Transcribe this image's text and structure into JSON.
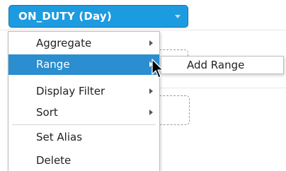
{
  "field_pill": {
    "label": "ON_DUTY (Day)",
    "color": "#1d9be0"
  },
  "context_menu": {
    "items": [
      {
        "label": "Aggregate",
        "has_submenu": true
      },
      {
        "label": "Range",
        "has_submenu": true,
        "highlighted": true
      },
      {
        "label": "Display Filter",
        "has_submenu": true
      },
      {
        "label": "Sort",
        "has_submenu": true
      },
      {
        "label": "Set Alias",
        "has_submenu": false
      },
      {
        "label": "Delete",
        "has_submenu": false
      }
    ],
    "highlight_color": "#2a8ed0"
  },
  "submenu": {
    "items": [
      {
        "label": "Add Range"
      }
    ]
  },
  "icons": {
    "pill_dropdown": "chevron-down-icon",
    "submenu_arrow": "chevron-right-icon",
    "cursor": "mouse-pointer-icon"
  }
}
